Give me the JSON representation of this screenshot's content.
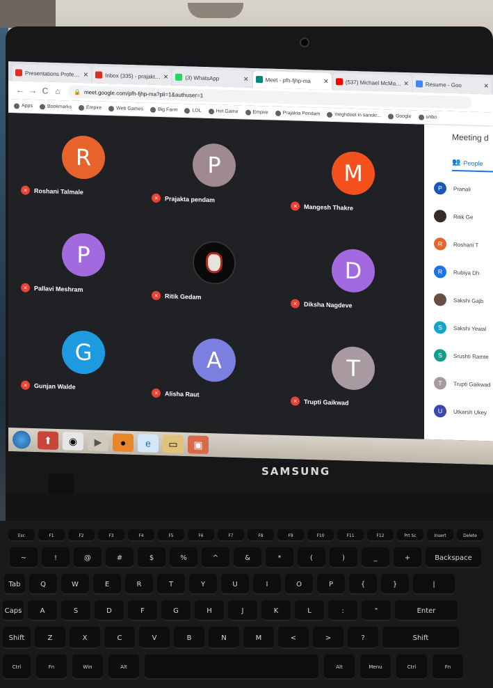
{
  "browser": {
    "tabs": [
      {
        "label": "Presentations Professio",
        "color": "#d93025"
      },
      {
        "label": "Inbox (335) - prajaktape",
        "color": "#d93025"
      },
      {
        "label": "(3) WhatsApp",
        "color": "#25d366"
      },
      {
        "label": "Meet - pfh-fjhp-ma",
        "color": "#00897b"
      },
      {
        "label": "(537) Michael McMahe",
        "color": "#ff0000"
      },
      {
        "label": "Resume - Goo",
        "color": "#4285f4"
      }
    ],
    "url": "meet.google.com/pfh-fjhp-ma?pli=1&authuser=1",
    "bookmarks": [
      "Apps",
      "Bookmarks",
      "Empire",
      "Web Games",
      "Big Farm",
      "LOL",
      "Hot Game",
      "Empire",
      "Prajakta Pendam",
      "meghdoot in sanskr...",
      "Google",
      "unbo"
    ]
  },
  "meet": {
    "participants": [
      {
        "initial": "R",
        "name": "Roshani Talmale",
        "color": "#e8632c"
      },
      {
        "initial": "P",
        "name": "Prajakta pendam",
        "color": "#9e8a8f"
      },
      {
        "initial": "M",
        "name": "Mangesh Thakre",
        "color": "#f4511e"
      },
      {
        "initial": "P",
        "name": "Pallavi Meshram",
        "color": "#a36ae0"
      },
      {
        "initial": "",
        "name": "Ritik Gedam",
        "color": "#0a0a0a",
        "image": true
      },
      {
        "initial": "D",
        "name": "Diksha Nagdeve",
        "color": "#a36ae0"
      },
      {
        "initial": "G",
        "name": "Gunjan Walde",
        "color": "#1e9be0"
      },
      {
        "initial": "A",
        "name": "Alisha Raut",
        "color": "#7b7fe0"
      },
      {
        "initial": "T",
        "name": "Trupti Gaikwad",
        "color": "#a89aa0"
      }
    ],
    "panel_title": "Meeting d",
    "people_tab": "People",
    "people_list": [
      {
        "initial": "P",
        "name": "Pranali",
        "color": "#1a57b8"
      },
      {
        "initial": "",
        "name": "Ritik Ge",
        "color": "#3a2a2a"
      },
      {
        "initial": "R",
        "name": "Roshani T",
        "color": "#e8632c"
      },
      {
        "initial": "R",
        "name": "Rubiya Dh",
        "color": "#1a73e8"
      },
      {
        "initial": "",
        "name": "Sakshi Gajb",
        "color": "#6d4c41"
      },
      {
        "initial": "S",
        "name": "Sakshi Yewal",
        "color": "#12a4c9"
      },
      {
        "initial": "S",
        "name": "Srushti Ramte",
        "color": "#129e8a"
      },
      {
        "initial": "T",
        "name": "Trupti Gaikwad",
        "color": "#a89aa0"
      },
      {
        "initial": "U",
        "name": "Utkarsh Ukey",
        "color": "#3949ab"
      }
    ]
  },
  "laptop": {
    "brand": "SAMSUNG"
  },
  "keyboard": {
    "row1": [
      "Esc",
      "F1",
      "F2",
      "F3",
      "F4",
      "F5",
      "F6",
      "F7",
      "F8",
      "F9",
      "F10",
      "F11",
      "F12",
      "Prt Sc",
      "Insert",
      "Delete"
    ],
    "row2": [
      "~",
      "!",
      "@",
      "#",
      "$",
      "%",
      "^",
      "&",
      "*",
      "(",
      ")",
      "_",
      "+",
      "Backspace"
    ],
    "row3": [
      "Tab",
      "Q",
      "W",
      "E",
      "R",
      "T",
      "Y",
      "U",
      "I",
      "O",
      "P",
      "{",
      "}",
      "|"
    ],
    "row4": [
      "Caps",
      "A",
      "S",
      "D",
      "F",
      "G",
      "H",
      "J",
      "K",
      "L",
      ":",
      "\"",
      "Enter"
    ],
    "row5": [
      "Shift",
      "Z",
      "X",
      "C",
      "V",
      "B",
      "N",
      "M",
      "<",
      ">",
      "?",
      "Shift"
    ],
    "row6": [
      "Ctrl",
      "Fn",
      "Win",
      "Alt",
      "",
      "Alt",
      "Menu",
      "Ctrl",
      "Fn"
    ]
  }
}
